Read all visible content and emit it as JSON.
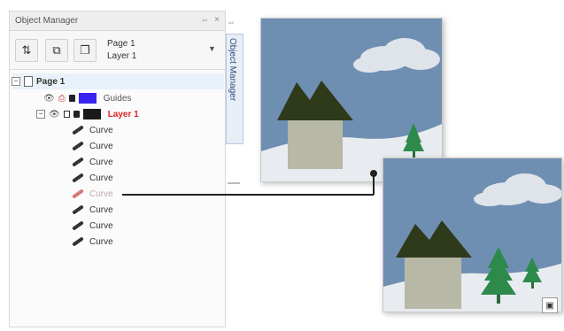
{
  "docker": {
    "title": "Object Manager",
    "page_select": "Page 1",
    "layer_select": "Layer 1",
    "tab_label": "Object Manager"
  },
  "tree": {
    "page": "Page 1",
    "guides": "Guides",
    "layer": "Layer 1",
    "curves": [
      "Curve",
      "Curve",
      "Curve",
      "Curve",
      "Curve",
      "Curve",
      "Curve",
      "Curve"
    ]
  },
  "colors": {
    "guides_swatch": "#3a22f0",
    "layer_swatch": "#1a1a1a",
    "layer_text": "#e02020",
    "sky": "#6f8fb2",
    "snow": "#e8ecf0",
    "roof": "#2f3a1a",
    "house": "#b7b8a6",
    "tree": "#2d8a4a"
  },
  "icons": {
    "toolbar": [
      "layer-properties-icon",
      "merge-icon",
      "new-layer-icon"
    ],
    "dropdown": "chevron-down-icon"
  }
}
